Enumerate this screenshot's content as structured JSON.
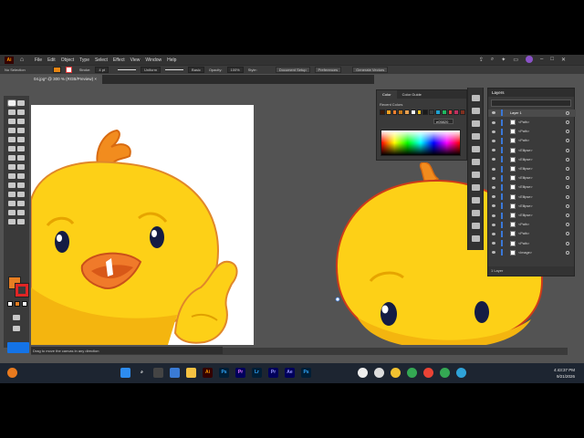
{
  "app": {
    "logo_label": "Ai",
    "menus": [
      "File",
      "Edit",
      "Object",
      "Type",
      "Select",
      "Effect",
      "View",
      "Window",
      "Help"
    ]
  },
  "control_bar": {
    "selection_label": "No Selection",
    "stroke_label": "Stroke:",
    "stroke_weight": "4 pt",
    "stroke_profile": "Uniform",
    "brush_label": "Basic",
    "opacity_label": "Opacity:",
    "opacity_value": "100%",
    "style_label": "Style:",
    "document_setup_label": "Document Setup",
    "preferences_label": "Preferences",
    "generate_vectors_label": "Generate Vectors"
  },
  "document": {
    "tab_title": "04.jpg* @ 300 % (RGB/Preview)",
    "zoom_value": "300%",
    "rotation_value": "0°",
    "page_value": "1",
    "tool_name": "Hand",
    "hint_text": "Drag to move the canvas in any direction"
  },
  "color_panel": {
    "tabs": [
      "Color",
      "Color Guide"
    ],
    "recent_label": "Recent Colors",
    "hex_value": "e05820",
    "recent_colors": [
      "#3a1a0a",
      "#f5a020",
      "#f08030",
      "#c87818",
      "#e8a050",
      "#ffffff",
      "#f0c020",
      "#1a1a1a",
      "#404040",
      "#1fa0d0",
      "#20b860",
      "#e04040",
      "#c03060",
      "#803020"
    ]
  },
  "layers_panel": {
    "title": "Layers",
    "footer_label": "1 Layer",
    "rows": [
      {
        "name": "Layer 1"
      },
      {
        "name": "<Path>"
      },
      {
        "name": "<Path>"
      },
      {
        "name": "<Path>"
      },
      {
        "name": "<Ellipse>"
      },
      {
        "name": "<Ellipse>"
      },
      {
        "name": "<Ellipse>"
      },
      {
        "name": "<Ellipse>"
      },
      {
        "name": "<Ellipse>"
      },
      {
        "name": "<Ellipse>"
      },
      {
        "name": "<Ellipse>"
      },
      {
        "name": "<Ellipse>"
      },
      {
        "name": "<Path>"
      },
      {
        "name": "<Path>"
      },
      {
        "name": "<Path>"
      },
      {
        "name": "<Image>"
      }
    ]
  },
  "taskbar": {
    "time": "4:43:37 PM",
    "date": "9/21/2026",
    "icons": [
      {
        "label": "Ai",
        "color": "#ff9a00",
        "bg": "#330000"
      },
      {
        "label": "Ps",
        "color": "#31a8ff",
        "bg": "#001e36"
      },
      {
        "label": "Pr",
        "color": "#ea77ff",
        "bg": "#00005b"
      },
      {
        "label": "Lr",
        "color": "#31a8ff",
        "bg": "#001e36"
      },
      {
        "label": "Pr",
        "color": "#9999ff",
        "bg": "#00005b"
      },
      {
        "label": "Ae",
        "color": "#9999ff",
        "bg": "#00005b"
      },
      {
        "label": "Ps",
        "color": "#31a8ff",
        "bg": "#001e36"
      }
    ]
  },
  "colors": {
    "chick_yellow": "#fdd017",
    "chick_outline": "#e0872a",
    "comb_orange": "#f28c1e",
    "beak_orange": "#f07a2a",
    "fill_swatch": "#e67e22",
    "stroke_swatch": "#e02525",
    "accent_blue": "#1473e6"
  }
}
